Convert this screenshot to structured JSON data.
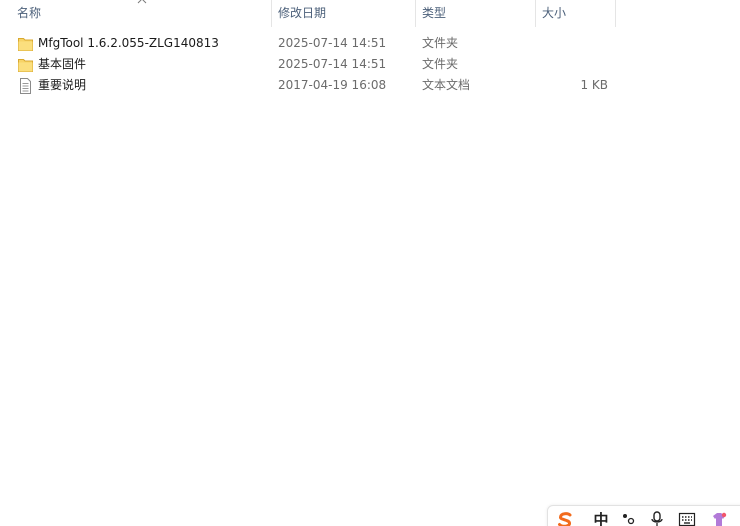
{
  "columns": {
    "name": "名称",
    "date": "修改日期",
    "type": "类型",
    "size": "大小"
  },
  "files": [
    {
      "name": "MfgTool 1.6.2.055-ZLG140813",
      "date": "2025-07-14 14:51",
      "type": "文件夹",
      "size": "",
      "icon": "folder-icon"
    },
    {
      "name": "基本固件",
      "date": "2025-07-14 14:51",
      "type": "文件夹",
      "size": "",
      "icon": "folder-icon"
    },
    {
      "name": "重要说明",
      "date": "2017-04-19 16:08",
      "type": "文本文档",
      "size": "1 KB",
      "icon": "text-document-icon"
    }
  ],
  "ime": {
    "logo_icon": "sogou-s-icon",
    "mode_label": "中",
    "punctuation_icon": "punctuation-icon",
    "voice_icon": "microphone-icon",
    "keyboard_icon": "keyboard-icon",
    "skin_icon": "skin-icon"
  },
  "colors": {
    "folder": "#f7d468",
    "header_text": "#4c607a",
    "ime_logo": "#f26b1d"
  }
}
